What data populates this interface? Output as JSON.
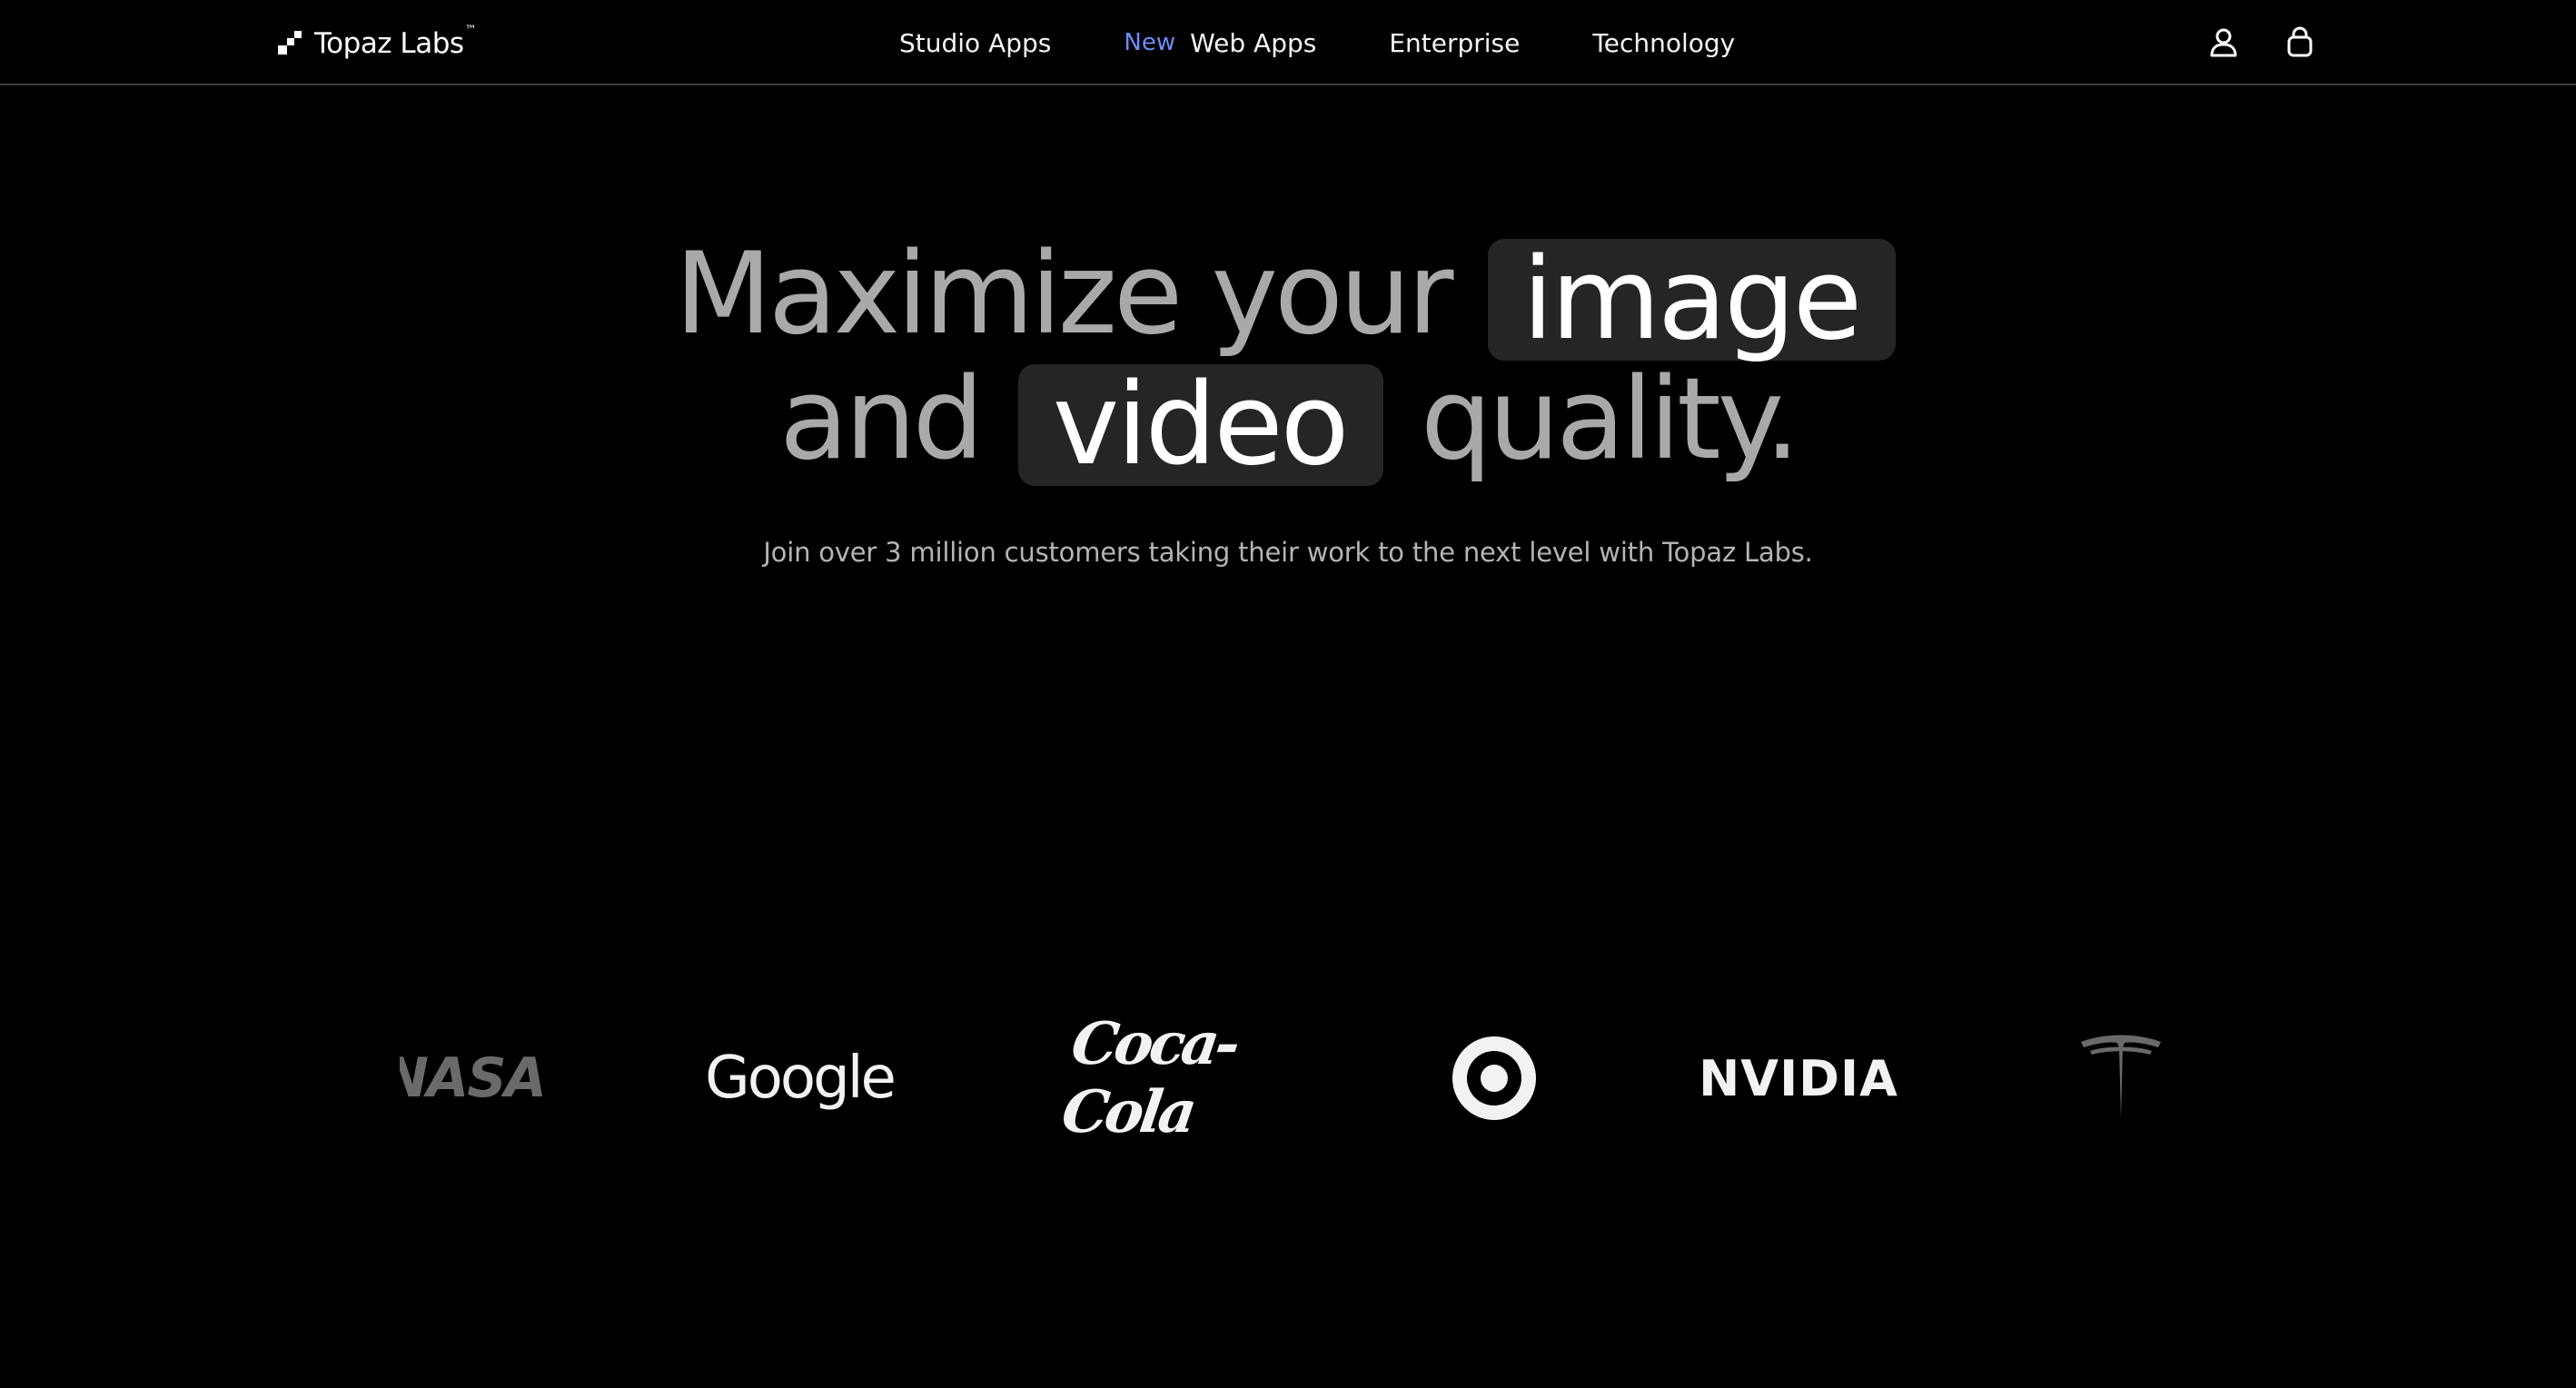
{
  "nav": {
    "logo": {
      "name": "Topaz Labs",
      "tm": "™",
      "icon": "topaz-logo-icon"
    },
    "links": [
      {
        "label": "Studio Apps",
        "badge": ""
      },
      {
        "label": "Web Apps",
        "badge": "New"
      },
      {
        "label": "Enterprise",
        "badge": ""
      },
      {
        "label": "Technology",
        "badge": ""
      }
    ],
    "icons": [
      "account-icon",
      "cart-icon"
    ],
    "badge_color": "#6d8dff"
  },
  "hero": {
    "line1_prefix": "Maximize your",
    "line1_highlight": "image",
    "line2_prefix": "and",
    "line2_highlight": "video",
    "line2_suffix": "quality.",
    "subtitle": "Join over 3 million customers taking their work to the next level with Topaz Labs."
  },
  "logos": {
    "brands": [
      {
        "name": "NASA",
        "text": "NASA"
      },
      {
        "name": "Google",
        "text": "Google"
      },
      {
        "name": "Coca-Cola",
        "text": "Coca-Cola"
      },
      {
        "name": "Target",
        "text": ""
      },
      {
        "name": "NVIDIA",
        "text": "NVIDIA"
      },
      {
        "name": "Tesla",
        "text": ""
      }
    ]
  },
  "colors": {
    "background": "#000000",
    "headline_muted": "#a9a9a9",
    "pill_bg": "#252525",
    "accent_new": "#6d8dff"
  }
}
